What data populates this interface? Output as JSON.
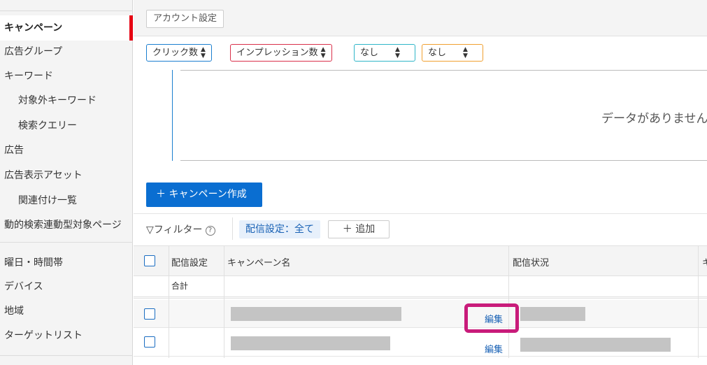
{
  "sidebar": {
    "items": [
      {
        "label": "キャンペーン",
        "active": true
      },
      {
        "label": "広告グループ"
      },
      {
        "label": "キーワード"
      },
      {
        "label": "対象外キーワード",
        "sub": true
      },
      {
        "label": "検索クエリー",
        "sub": true
      },
      {
        "label": "広告"
      },
      {
        "label": "広告表示アセット"
      },
      {
        "label": "関連付け一覧",
        "sub": true
      },
      {
        "label": "動的検索連動型対象ページ"
      },
      {
        "label": "曜日・時間帯"
      },
      {
        "label": "デバイス"
      },
      {
        "label": "地域"
      },
      {
        "label": "ターゲットリスト"
      }
    ],
    "accent_color": "#e60012"
  },
  "header": {
    "account_settings": "アカウント設定"
  },
  "metrics": [
    {
      "label": "クリック数",
      "color": "#1b7fd0"
    },
    {
      "label": "インプレッション数",
      "color": "#d9304a"
    },
    {
      "label": "なし",
      "color": "#2fb5c8"
    },
    {
      "label": "なし",
      "color": "#f0a030"
    }
  ],
  "chart": {
    "no_data": "データがありません"
  },
  "actions": {
    "create_campaign": "＋ キャンペーン作成"
  },
  "filter": {
    "label": "フィルター",
    "help": "?",
    "chip": "配信設定：全て",
    "add": "＋ 追加"
  },
  "table": {
    "columns": [
      "配信設定",
      "キャンペーン名",
      "配信状況",
      "キ"
    ],
    "total_label": "合計",
    "rows": [
      {
        "edit": "編集"
      },
      {
        "edit": "編集"
      }
    ]
  },
  "brand_color": "#0a6ed1",
  "highlight_color": "#c81b7a"
}
